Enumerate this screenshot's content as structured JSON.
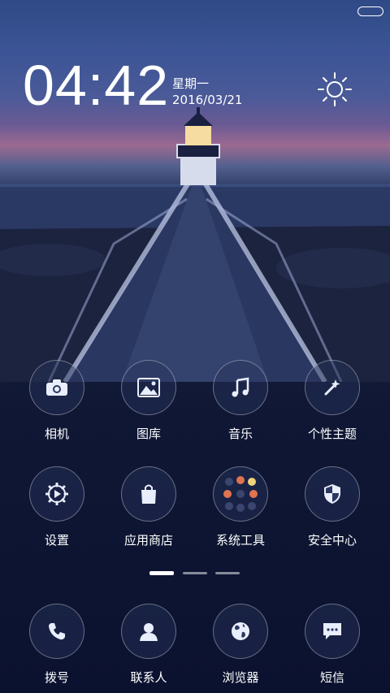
{
  "status_bar": {
    "battery_icon": "battery-pill-icon"
  },
  "clock": {
    "time": "04:42",
    "weekday": "星期一",
    "date": "2016/03/21"
  },
  "weather": {
    "icon": "sun-icon"
  },
  "apps": [
    {
      "label": "相机",
      "icon": "camera-icon"
    },
    {
      "label": "图库",
      "icon": "gallery-icon"
    },
    {
      "label": "音乐",
      "icon": "music-note-icon"
    },
    {
      "label": "个性主题",
      "icon": "magic-wand-icon"
    },
    {
      "label": "设置",
      "icon": "gear-icon"
    },
    {
      "label": "应用商店",
      "icon": "shopping-bag-icon"
    },
    {
      "label": "系统工具",
      "icon": "folder-icon"
    },
    {
      "label": "安全中心",
      "icon": "shield-icon"
    }
  ],
  "page_indicator": {
    "pages": 3,
    "active": 0
  },
  "dock": [
    {
      "label": "拨号",
      "icon": "phone-icon"
    },
    {
      "label": "联系人",
      "icon": "contact-icon"
    },
    {
      "label": "浏览器",
      "icon": "globe-icon"
    },
    {
      "label": "短信",
      "icon": "message-icon"
    }
  ]
}
